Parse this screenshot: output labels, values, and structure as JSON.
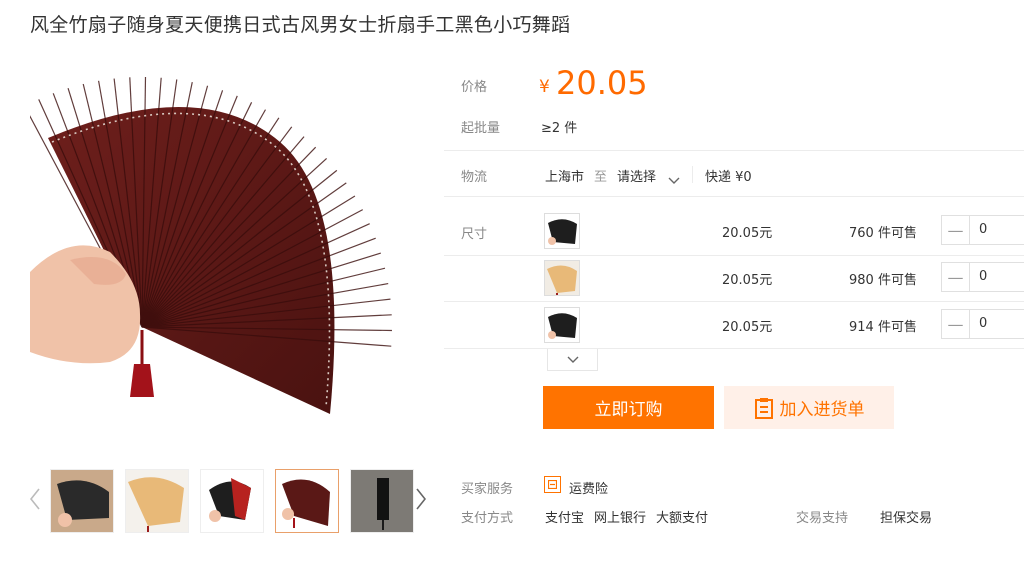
{
  "product": {
    "title": "风全竹扇子随身夏天便携日式古风男女士折扇手工黑色小巧舞蹈"
  },
  "price": {
    "label": "价格",
    "currency": "¥",
    "value": "20.05"
  },
  "moq": {
    "label": "起批量",
    "value": "≥2 件"
  },
  "shipping": {
    "label": "物流",
    "from": "上海市",
    "to_word": "至",
    "select": "请选择",
    "express": "快递 ¥0"
  },
  "size": {
    "label": "尺寸",
    "variants": [
      {
        "price": "20.05元",
        "stock": "760 件可售",
        "qty": "0",
        "color": "black"
      },
      {
        "price": "20.05元",
        "stock": "980 件可售",
        "qty": "0",
        "color": "natural"
      },
      {
        "price": "20.05元",
        "stock": "914 件可售",
        "qty": "0",
        "color": "black"
      }
    ]
  },
  "actions": {
    "order": "立即订购",
    "cart": "加入进货单"
  },
  "services": {
    "buyer_label": "买家服务",
    "buyer_item": "运费险",
    "pay_label": "支付方式",
    "pay_methods": [
      "支付宝",
      "网上银行",
      "大额支付"
    ],
    "trade_label": "交易支持",
    "trade_item": "担保交易"
  },
  "thumbnails": [
    "black-fan",
    "natural-fan",
    "red-black-fan",
    "burgundy-fan",
    "black-fan-box"
  ],
  "colors": {
    "accent": "#ff6a00",
    "button": "#ff7300",
    "cart_bg": "#fff0e8"
  },
  "icons": [
    "zoom-icon",
    "chevron-left-icon",
    "chevron-right-icon",
    "chevron-down-icon",
    "minus-icon",
    "clipboard-icon",
    "shipping-insurance-icon"
  ]
}
